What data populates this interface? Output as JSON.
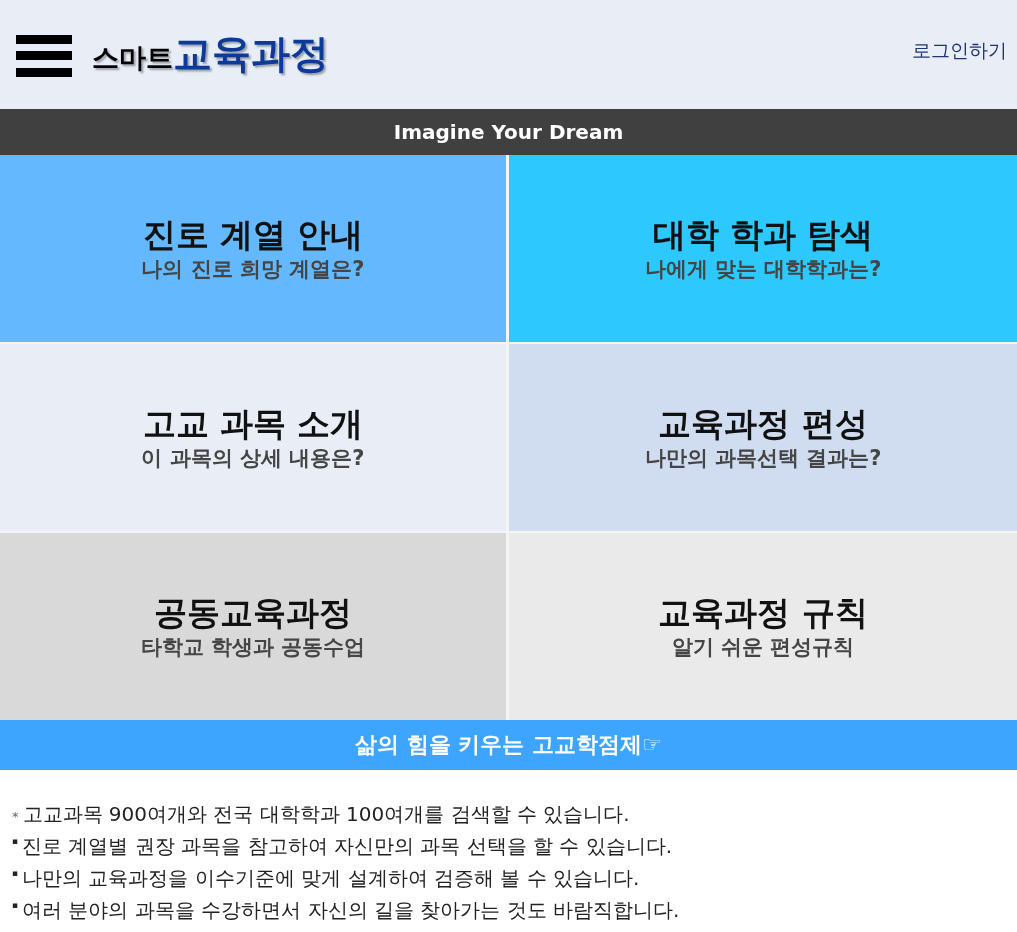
{
  "header": {
    "logo": {
      "prefix": "스마트",
      "main": "교육과정"
    },
    "login_link": "로그인하기"
  },
  "tagline_banner": "Imagine Your Dream",
  "tiles": [
    {
      "title": "진로 계열 안내",
      "subtitle": "나의 진로 희망 계열은?",
      "color": "#64b9fe"
    },
    {
      "title": "대학 학과 탐색",
      "subtitle": "나에게 맞는 대학학과는?",
      "color": "#2cc8fe"
    },
    {
      "title": "고교 과목 소개",
      "subtitle": "이 과목의 상세 내용은?",
      "color": "#e8edf6"
    },
    {
      "title": "교육과정 편성",
      "subtitle": "나만의 과목선택 결과는?",
      "color": "#d0ddf0"
    },
    {
      "title": "공동교육과정",
      "subtitle": "타학교 학생과 공동수업",
      "color": "#d9d9d9"
    },
    {
      "title": "교육과정 규칙",
      "subtitle": "알기 쉬운 편성규칙",
      "color": "#eaeaea"
    }
  ],
  "promo_banner": "삶의 힘을 키우는 고교학점제☞",
  "notes": [
    {
      "marker": "*",
      "text": "고교과목 900여개와 전국 대학학과 100여개를 검색할 수 있습니다."
    },
    {
      "marker": "▪",
      "text": "진로 계열별 권장 과목을 참고하여 자신만의 과목 선택을 할 수 있습니다."
    },
    {
      "marker": "▪",
      "text": "나만의 교육과정을 이수기준에 맞게 설계하여 검증해 볼 수 있습니다."
    },
    {
      "marker": "▪",
      "text": "여러 분야의 과목을 수강하면서 자신의 길을 찾아가는 것도 바람직합니다."
    }
  ]
}
